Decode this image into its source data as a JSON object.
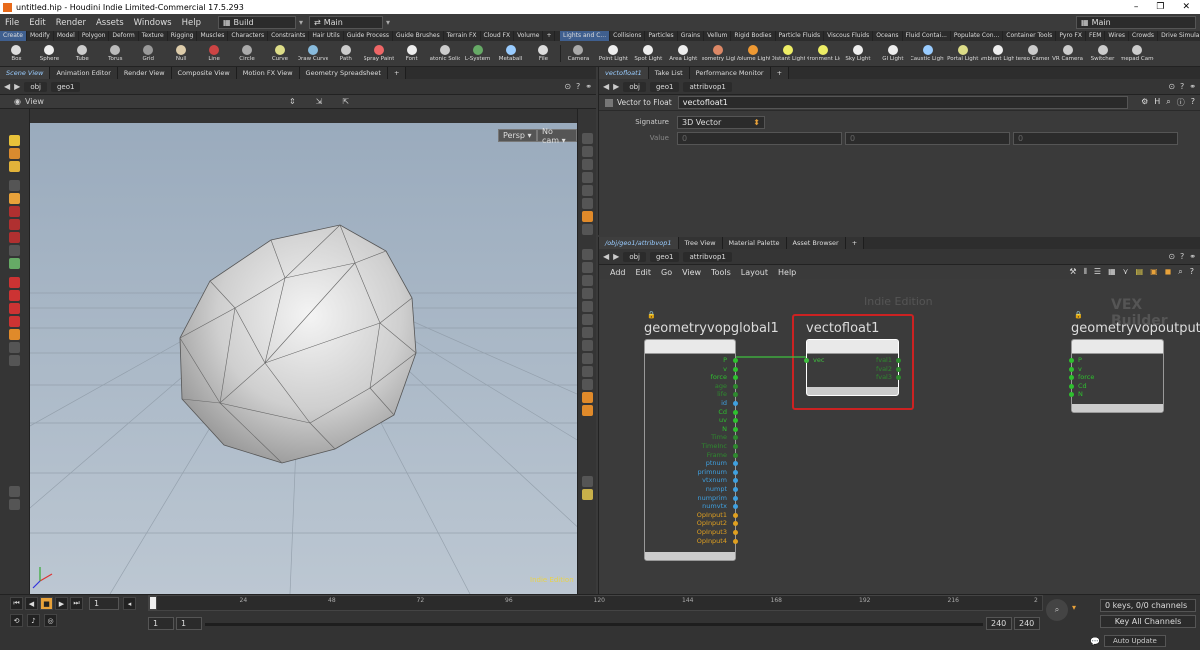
{
  "window": {
    "title": "untitled.hip - Houdini Indie Limited-Commercial 17.5.293",
    "controls": [
      "–",
      "❐",
      "✕"
    ]
  },
  "menu": {
    "items": [
      "File",
      "Edit",
      "Render",
      "Assets",
      "Windows",
      "Help"
    ],
    "desktop": "Build",
    "main_label": "Main",
    "right_desktop": "Main"
  },
  "shelf_tabs_left": [
    "Create",
    "Modify",
    "Model",
    "Polygon",
    "Deform",
    "Texture",
    "Rigging",
    "Muscles",
    "Characters",
    "Constraints",
    "Hair Utils",
    "Guide Process",
    "Guide Brushes",
    "Terrain FX",
    "Cloud FX",
    "Volume",
    "+"
  ],
  "shelf_tabs_right": [
    "Lights and C...",
    "Collisions",
    "Particles",
    "Grains",
    "Vellum",
    "Rigid Bodies",
    "Particle Fluids",
    "Viscous Fluids",
    "Oceans",
    "Fluid Contai...",
    "Populate Con...",
    "Container Tools",
    "Pyro FX",
    "FEM",
    "Wires",
    "Crowds",
    "Drive Simula..."
  ],
  "tools_left": [
    "Box",
    "Sphere",
    "Tube",
    "Torus",
    "Grid",
    "Null",
    "Line",
    "Circle",
    "Curve",
    "Draw Curve",
    "Path",
    "Spray Paint",
    "Font",
    "Platonic Solids",
    "L-System",
    "Metaball",
    "File"
  ],
  "tools_right": [
    "Camera",
    "Point Light",
    "Spot Light",
    "Area Light",
    "Geometry Light",
    "Volume Light",
    "Distant Light",
    "Environment Light",
    "Sky Light",
    "GI Light",
    "Caustic Light",
    "Portal Light",
    "Ambient Light",
    "Stereo Camera",
    "VR Camera",
    "Switcher",
    "Gamepad Camera"
  ],
  "left_pane": {
    "tabs": [
      "Scene View",
      "Animation Editor",
      "Render View",
      "Composite View",
      "Motion FX View",
      "Geometry Spreadsheet",
      "+"
    ],
    "path": [
      "obj",
      "geo1"
    ],
    "view_label": "View",
    "persp": "Persp ▾",
    "cam": "No cam ▾",
    "watermark": "Indie Edition"
  },
  "param_pane": {
    "tabs": [
      "vectofloat1",
      "Take List",
      "Performance Monitor",
      "+"
    ],
    "path": [
      "obj",
      "geo1",
      "attribvop1"
    ],
    "node_type": "Vector to Float",
    "node_name": "vectofloat1",
    "signature_label": "Signature",
    "signature_value": "3D Vector",
    "value_label": "Value",
    "value_fields": [
      "0",
      "0",
      "0"
    ]
  },
  "network_pane": {
    "tabs": [
      "/obj/geo1/attribvop1",
      "Tree View",
      "Material Palette",
      "Asset Browser",
      "+"
    ],
    "path": [
      "obj",
      "geo1",
      "attribvop1"
    ],
    "menu": [
      "Add",
      "Edit",
      "Go",
      "View",
      "Tools",
      "Layout",
      "Help"
    ],
    "watermark": "Indie Edition",
    "context": "VEX Builder",
    "nodes": {
      "global": {
        "title": "geometryvopglobal1",
        "outputs": [
          "P",
          "v",
          "force",
          "age",
          "life",
          "id",
          "Cd",
          "uv",
          "N",
          "Time",
          "TimeInc",
          "Frame",
          "ptnum",
          "primnum",
          "vtxnum",
          "numpt",
          "numprim",
          "numvtx",
          "OpInput1",
          "OpInput2",
          "OpInput3",
          "OpInput4"
        ]
      },
      "vectofloat": {
        "title": "vectofloat1",
        "input": "vec",
        "outputs": [
          "fval1",
          "fval2",
          "fval3"
        ]
      },
      "output": {
        "title": "geometryvopoutput1",
        "inputs": [
          "P",
          "v",
          "force",
          "Cd",
          "N"
        ]
      }
    }
  },
  "timeline": {
    "current_frame": "1",
    "ticks": [
      "1",
      "24",
      "48",
      "72",
      "96",
      "120",
      "144",
      "168",
      "192",
      "216",
      "2"
    ],
    "range_start": "1",
    "range_start2": "1",
    "range_end": "240",
    "range_end2": "240",
    "keys_info": "0 keys, 0/0 channels",
    "key_all": "Key All Channels",
    "auto_update": "Auto Update"
  }
}
